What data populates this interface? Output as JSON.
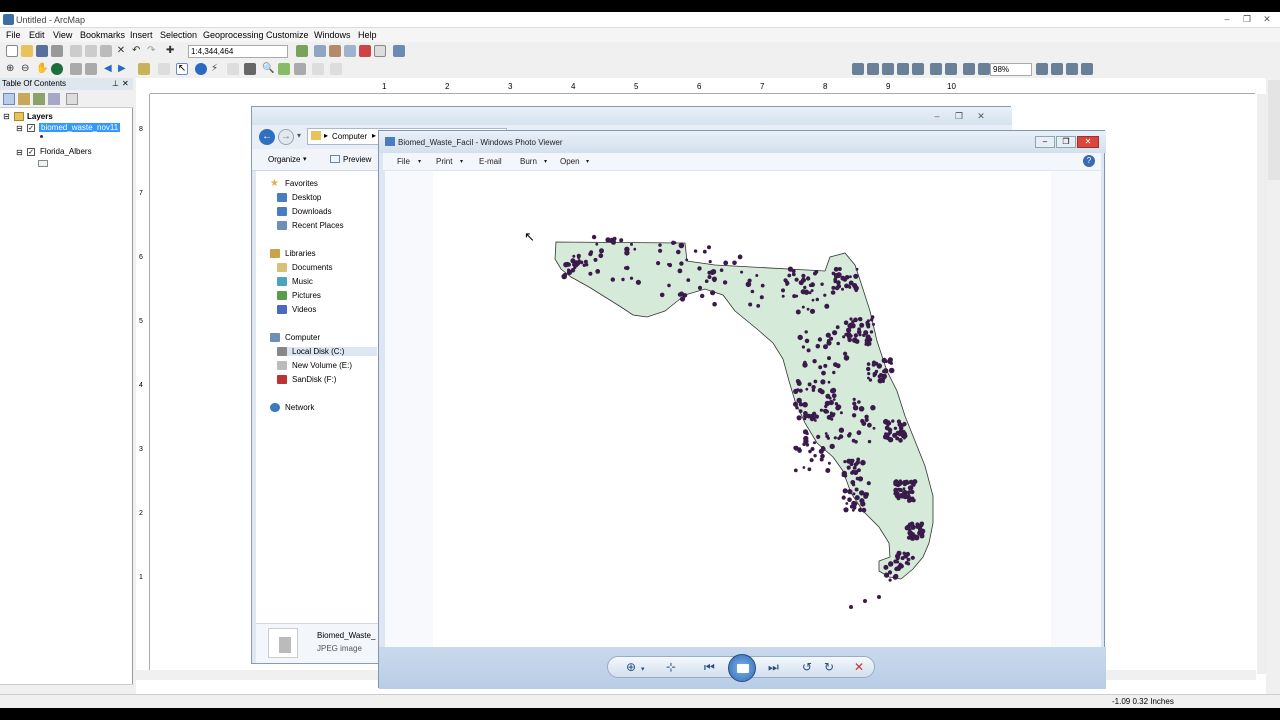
{
  "arcmap": {
    "title": "Untitled - ArcMap",
    "menu": [
      "File",
      "Edit",
      "View",
      "Bookmarks",
      "Insert",
      "Selection",
      "Geoprocessing",
      "Customize",
      "Windows",
      "Help"
    ],
    "scale": "1:4,344,464",
    "zoom": "98%",
    "status_coords": "-1.09  0.32 Inches"
  },
  "toc": {
    "header": "Table Of Contents",
    "root": "Layers",
    "layers": [
      {
        "name": "biomed_waste_nov11",
        "checked": true,
        "selected": true
      },
      {
        "name": "Florida_Albers",
        "checked": true,
        "selected": false
      }
    ]
  },
  "ruler": {
    "ticks": [
      "1",
      "2",
      "3",
      "4",
      "5",
      "6",
      "7",
      "8",
      "9",
      "10"
    ],
    "left_ticks": [
      "8",
      "7",
      "6",
      "5",
      "4",
      "3",
      "2",
      "1"
    ]
  },
  "explorer": {
    "breadcrumb": "Computer",
    "organize": "Organize",
    "preview": "Preview",
    "nav": {
      "favorites": "Favorites",
      "desktop": "Desktop",
      "downloads": "Downloads",
      "recent": "Recent Places",
      "libraries": "Libraries",
      "documents": "Documents",
      "music": "Music",
      "pictures": "Pictures",
      "videos": "Videos",
      "computer": "Computer",
      "local_disk": "Local Disk (C:)",
      "new_volume": "New Volume (E:)",
      "sandisk": "SanDisk (F:)",
      "network": "Network"
    },
    "footer_name": "Biomed_Waste_",
    "footer_type": "JPEG image"
  },
  "viewer": {
    "title": "Biomed_Waste_Facil - Windows Photo Viewer",
    "menu": {
      "file": "File",
      "print": "Print",
      "email": "E-mail",
      "burn": "Burn",
      "open": "Open"
    },
    "help": "?"
  },
  "colors": {
    "florida_fill": "#d5ead8",
    "facility_dots": "#3a1a4a",
    "toc_selection": "#3399ff"
  }
}
